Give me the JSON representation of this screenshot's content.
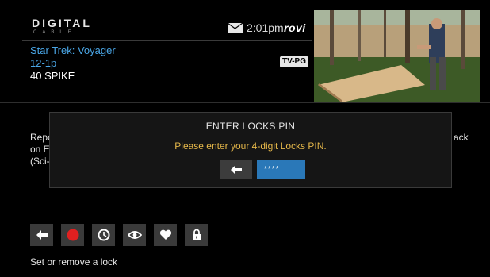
{
  "header": {
    "logo_main": "DIGITAL",
    "logo_sub": "CABLE",
    "time": "2:01pm",
    "brand": "rovi",
    "mail_icon": "envelope-icon"
  },
  "program": {
    "title": "Star Trek: Voyager",
    "time_slot": "12-1p",
    "channel": "40 SPIKE",
    "rating": "TV-PG"
  },
  "background_text": {
    "left_lines": [
      "Repo",
      "on E",
      "(Sci-"
    ],
    "right_fragment": "ack"
  },
  "dialog": {
    "title": "ENTER LOCKS PIN",
    "message": "Please enter your 4-digit Locks PIN.",
    "pin_value": "****",
    "back_icon": "arrow-left-icon"
  },
  "actions": [
    {
      "icon": "arrow-left-icon"
    },
    {
      "icon": "record-icon",
      "color": "#e02020"
    },
    {
      "icon": "clock-icon"
    },
    {
      "icon": "eye-icon"
    },
    {
      "icon": "heart-icon"
    },
    {
      "icon": "lock-icon"
    }
  ],
  "footer": {
    "label": "Set or remove a lock"
  },
  "colors": {
    "accent_blue": "#4aa6e6",
    "pin_field": "#2a78b8",
    "message_yellow": "#e6b84a"
  }
}
